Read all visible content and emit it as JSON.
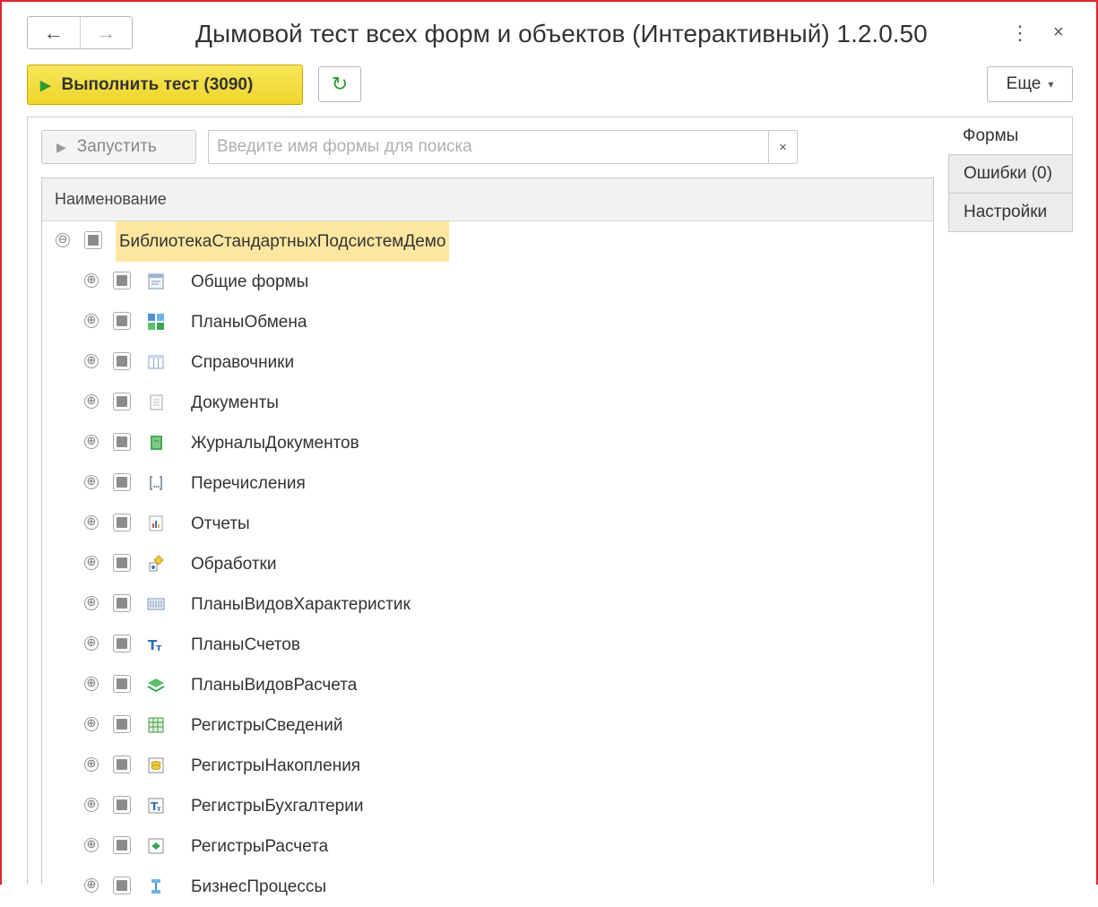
{
  "window": {
    "title": "Дымовой тест всех форм и объектов (Интерактивный) 1.2.0.50",
    "nav": {
      "back_label": "←",
      "forward_label": "→"
    },
    "more_dots": "⋮",
    "close_label": "×"
  },
  "toolbar": {
    "run_test_label": "Выполнить тест (3090)",
    "refresh_icon": "↻",
    "more_label": "Еще",
    "more_caret": "▾"
  },
  "forms_panel": {
    "start_label": "Запустить",
    "search": {
      "value": "",
      "placeholder": "Введите имя формы для поиска",
      "clear_label": "×"
    },
    "tree": {
      "column_header": "Наименование",
      "root": {
        "label": "БиблиотекаСтандартныхПодсистемДемо",
        "expander": "⊖"
      },
      "items": [
        {
          "label": "Общие формы",
          "icon": "common-forms-icon",
          "expander": "⊕"
        },
        {
          "label": "ПланыОбмена",
          "icon": "exchange-plans-icon",
          "expander": "⊕"
        },
        {
          "label": "Справочники",
          "icon": "catalogs-icon",
          "expander": "⊕"
        },
        {
          "label": "Документы",
          "icon": "documents-icon",
          "expander": "⊕"
        },
        {
          "label": "ЖурналыДокументов",
          "icon": "document-journals-icon",
          "expander": "⊕"
        },
        {
          "label": "Перечисления",
          "icon": "enums-icon",
          "expander": "⊕"
        },
        {
          "label": "Отчеты",
          "icon": "reports-icon",
          "expander": "⊕"
        },
        {
          "label": "Обработки",
          "icon": "data-processors-icon",
          "expander": "⊕"
        },
        {
          "label": "ПланыВидовХарактеристик",
          "icon": "characteristic-types-icon",
          "expander": "⊕"
        },
        {
          "label": "ПланыСчетов",
          "icon": "chart-of-accounts-icon",
          "expander": "⊕"
        },
        {
          "label": "ПланыВидовРасчета",
          "icon": "calculation-types-icon",
          "expander": "⊕"
        },
        {
          "label": "РегистрыСведений",
          "icon": "information-registers-icon",
          "expander": "⊕"
        },
        {
          "label": "РегистрыНакопления",
          "icon": "accumulation-registers-icon",
          "expander": "⊕"
        },
        {
          "label": "РегистрыБухгалтерии",
          "icon": "accounting-registers-icon",
          "expander": "⊕"
        },
        {
          "label": "РегистрыРасчета",
          "icon": "calculation-registers-icon",
          "expander": "⊕"
        },
        {
          "label": "БизнесПроцессы",
          "icon": "business-processes-icon",
          "expander": "⊕"
        }
      ]
    }
  },
  "side_tabs": [
    {
      "label": "Формы",
      "active": true
    },
    {
      "label": "Ошибки (0)",
      "active": false
    },
    {
      "label": "Настройки",
      "active": false
    }
  ],
  "colors": {
    "run_button": "#efd62a",
    "selected_row": "#fde7a0",
    "frame": "#e0242a"
  }
}
